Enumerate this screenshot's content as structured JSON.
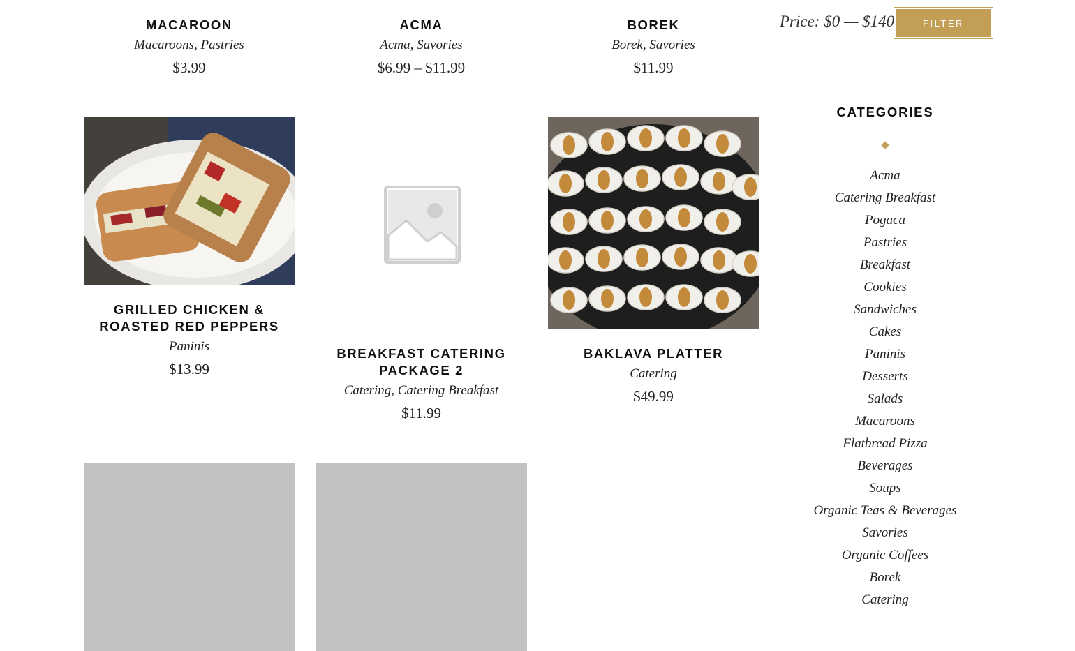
{
  "products": [
    {
      "title": "Macaroon",
      "categories": "Macaroons, Pastries",
      "price": "$3.99"
    },
    {
      "title": "Acma",
      "categories": "Acma, Savories",
      "price": "$6.99 – $11.99"
    },
    {
      "title": "Borek",
      "categories": "Borek, Savories",
      "price": "$11.99"
    },
    {
      "title": "Grilled Chicken & Roasted Red Peppers",
      "categories": "Paninis",
      "price": "$13.99"
    },
    {
      "title": "Breakfast Catering Package 2",
      "categories": "Catering, Catering Breakfast",
      "price": "$11.99"
    },
    {
      "title": "Baklava Platter",
      "categories": "Catering",
      "price": "$49.99"
    }
  ],
  "price_filter": {
    "label": "Price: $0 — $140",
    "button_label": "FILTER"
  },
  "categories_widget": {
    "heading": "CATEGORIES",
    "items": [
      "Acma",
      "Catering Breakfast",
      "Pogaca",
      "Pastries",
      "Breakfast",
      "Cookies",
      "Sandwiches",
      "Cakes",
      "Paninis",
      "Desserts",
      "Salads",
      "Macaroons",
      "Flatbread Pizza",
      "Beverages",
      "Soups",
      "Organic Teas & Beverages",
      "Savories",
      "Organic Coffees",
      "Borek",
      "Catering"
    ]
  },
  "colors": {
    "accent": "#c39f55",
    "placeholder_gray": "#c2c2c2"
  },
  "icons": {
    "placeholder": "image-placeholder-icon"
  }
}
